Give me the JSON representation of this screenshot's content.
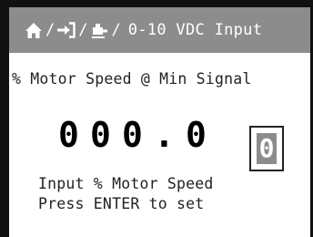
{
  "header": {
    "icons": [
      "home-icon",
      "input-arrow-icon",
      "motor-icon"
    ],
    "separator": "/",
    "title": "0-10 VDC Input"
  },
  "parameter": {
    "label": "% Motor Speed @ Min Signal"
  },
  "value": {
    "digits": [
      "0",
      "0",
      "0",
      "0",
      "0"
    ],
    "decimal_point": ".",
    "selected_digit_index": 4
  },
  "hints": {
    "line1": "Input % Motor Speed",
    "line2": "Press ENTER to set"
  },
  "colors": {
    "header_bg": "#8c8c8c",
    "header_text": "#ffffff",
    "selected_bg": "#8c8c8c",
    "text": "#222222"
  }
}
